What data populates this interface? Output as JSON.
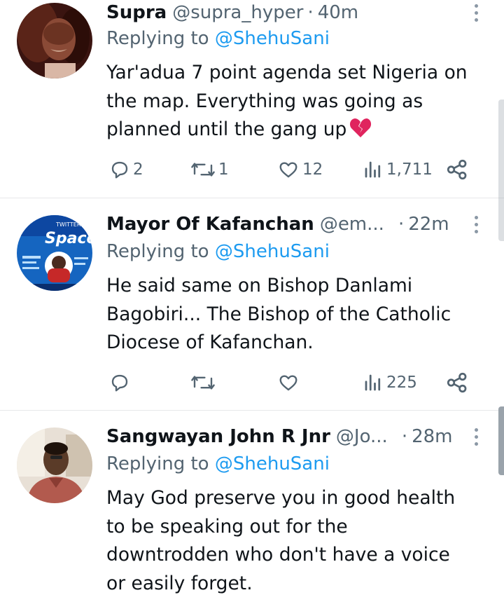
{
  "colors": {
    "accent": "#1d9bf0",
    "muted": "#536471",
    "text": "#0f1419",
    "divider": "#e6e8ea",
    "heart_emoji": "#e0245e"
  },
  "replies": [
    {
      "display_name": "Supra",
      "handle": "@supra_hyper",
      "separator": "·",
      "time": "40m",
      "replying_prefix": "Replying to",
      "replying_to": "@ShehuSani",
      "text_lines": [
        "Yar'adua 7 point agenda set Nigeria on",
        "the map. Everything was going as",
        "planned until the gang up"
      ],
      "emoji": "broken-heart-emoji",
      "replies_count": "2",
      "reposts_count": "1",
      "likes_count": "12",
      "views_count": "1,711"
    },
    {
      "display_name": "Mayor Of Kafanchan",
      "handle": "@em...",
      "separator": "·",
      "time": "22m",
      "replying_prefix": "Replying to",
      "replying_to": "@ShehuSani",
      "text_lines": [
        "He said same on Bishop Danlami",
        "Bagobiri... The Bishop of the Catholic",
        "Diocese of Kafanchan."
      ],
      "avatar_text_top": "TWITTER",
      "avatar_text_main": "Space",
      "replies_count": "",
      "reposts_count": "",
      "likes_count": "",
      "views_count": "225"
    },
    {
      "display_name": "Sangwayan John R Jnr",
      "handle": "@Jo...",
      "separator": "·",
      "time": "28m",
      "replying_prefix": "Replying to",
      "replying_to": "@ShehuSani",
      "text_lines": [
        "May God preserve you in good health",
        "to be speaking out for the",
        "downtrodden who don't have a voice",
        "or easily forget."
      ]
    }
  ]
}
